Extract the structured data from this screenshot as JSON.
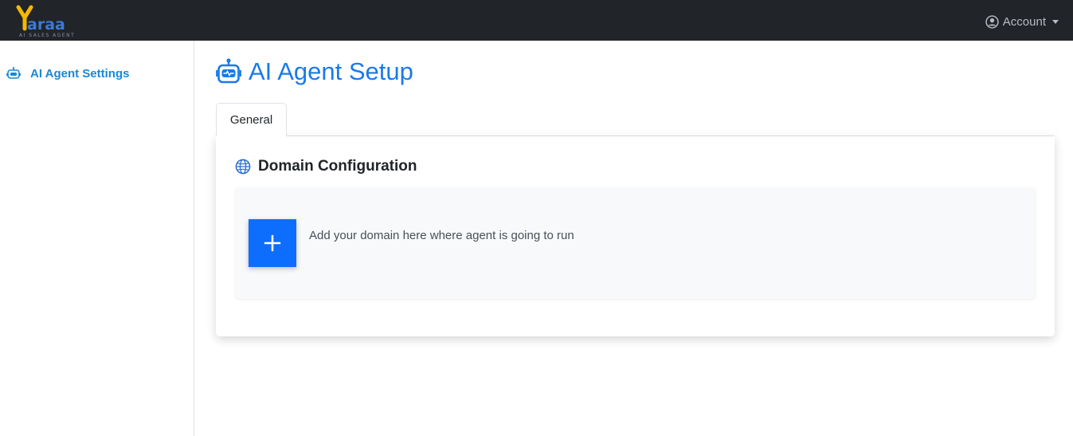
{
  "header": {
    "logo_text": "Yaraa",
    "logo_tagline": "AI SALES AGENT",
    "account_label": "Account"
  },
  "sidebar": {
    "items": [
      {
        "label": "AI Agent Settings",
        "icon": "robot-icon",
        "active": true
      }
    ]
  },
  "main": {
    "page_title": "AI Agent Setup",
    "tabs": [
      {
        "label": "General",
        "active": true
      }
    ],
    "section": {
      "title": "Domain Configuration",
      "icon": "globe-icon",
      "add_button_icon": "plus-icon",
      "add_hint": "Add your domain here where agent is going to run"
    }
  },
  "colors": {
    "topbar": "#212429",
    "accent": "#1a7ae8",
    "sidebar_active": "#1a87d6",
    "button": "#0d6efd",
    "logo_yellow": "#f5b800",
    "logo_blue": "#3a7bd5"
  }
}
